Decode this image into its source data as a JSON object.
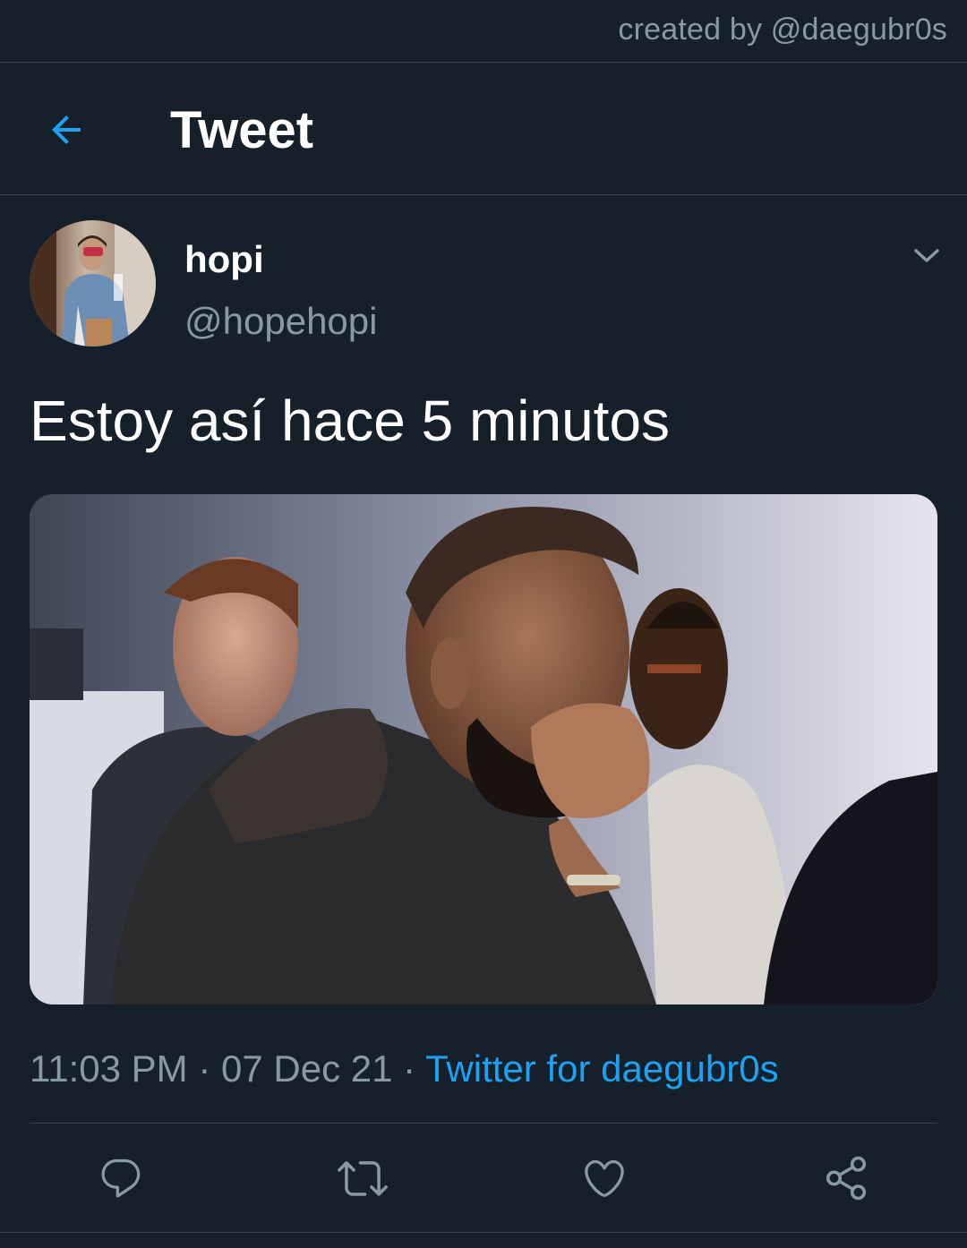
{
  "watermark": "created by @daegubr0s",
  "header": {
    "back_icon": "arrow-left-icon",
    "title": "Tweet"
  },
  "tweet": {
    "author": {
      "display_name": "hopi",
      "handle": "@hopehopi",
      "avatar": "profile-photo"
    },
    "options_icon": "chevron-down-icon",
    "text": "Estoy así hace 5 minutos",
    "media": {
      "type": "photo",
      "subject": "man covering mouth with hand in surprise"
    },
    "time": "11:03 PM",
    "separator": "·",
    "date": "07 Dec 21",
    "source": "Twitter for daegubr0s"
  },
  "actions": [
    {
      "name": "reply",
      "icon": "reply-icon"
    },
    {
      "name": "retweet",
      "icon": "retweet-icon"
    },
    {
      "name": "like",
      "icon": "heart-icon"
    },
    {
      "name": "share",
      "icon": "share-icon"
    }
  ],
  "colors": {
    "background": "#15202b",
    "divider": "#38444d",
    "text_primary": "#ffffff",
    "text_secondary": "#8899a6",
    "accent": "#1da1f2"
  }
}
